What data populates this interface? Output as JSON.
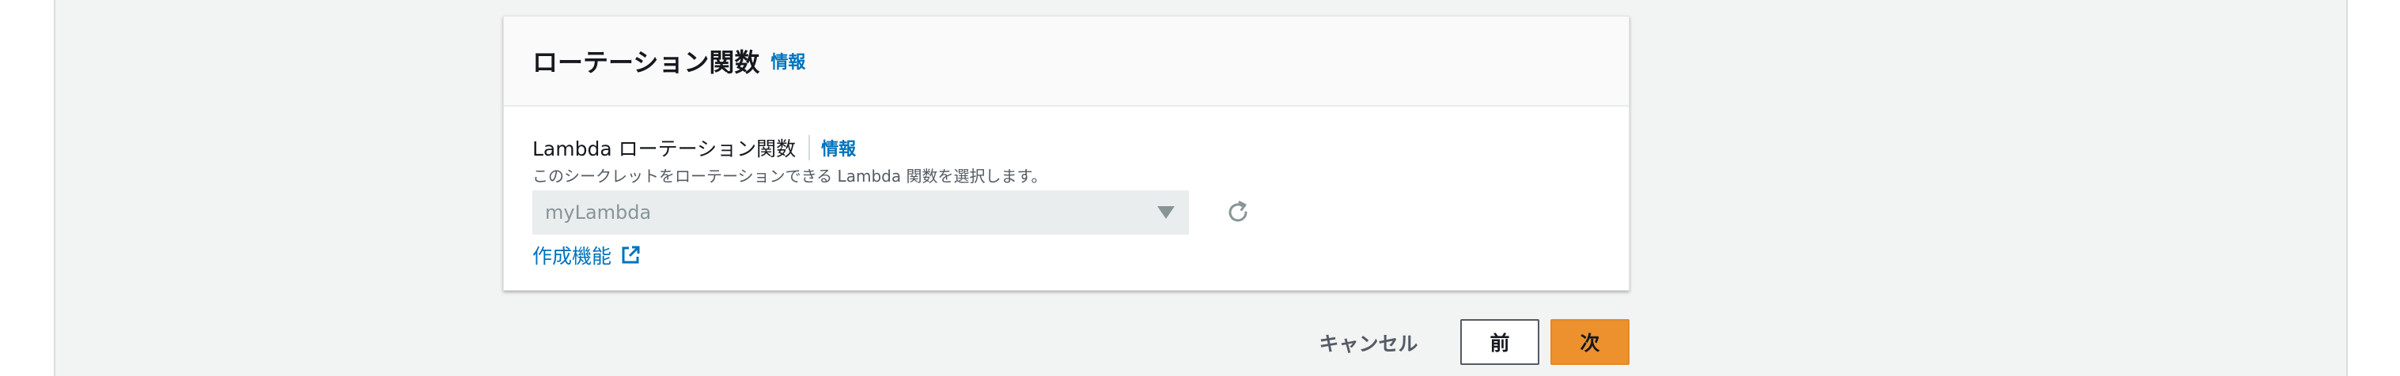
{
  "section": {
    "title": "ローテーション関数",
    "info_link": "情報"
  },
  "field": {
    "label": "Lambda ローテーション関数",
    "info_link": "情報",
    "description": "このシークレットをローテーションできる Lambda 関数を選択します。",
    "select_value": "myLambda",
    "create_link": "作成機能"
  },
  "footer": {
    "cancel_label": "キャンセル",
    "prev_label": "前",
    "next_label": "次"
  },
  "colors": {
    "link": "#0073bb",
    "primary_button": "#ec912d",
    "background": "#f2f3f3"
  }
}
